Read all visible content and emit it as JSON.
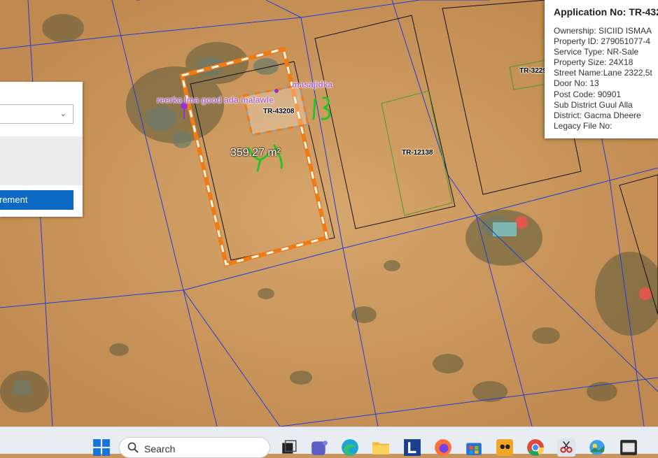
{
  "map": {
    "parcel_ids": {
      "subject": "TR-43208",
      "right": "TR-12138",
      "far_right": "TR-3229"
    },
    "poi_labels": {
      "left": "reerka lma good ada malawle",
      "right": "masajidka"
    },
    "measurement": "359.27 m²",
    "annotations": {
      "handwritten_number": "18",
      "handwritten_text": "ڈٹ"
    },
    "colors": {
      "selection": "#f07a14",
      "grid_lines": "#1e3fd6",
      "parcel_green": "#4c9a2a",
      "parcel_black": "#111111"
    }
  },
  "left_panel": {
    "button_label": "rement",
    "dropdown_value": ""
  },
  "popup": {
    "title": "Application No: TR-432",
    "ownership": "Ownership: SICIID ISMAA",
    "property_id": "Property ID: 279051077-4",
    "service_type": "Service Type: NR-Sale",
    "property_size": "Property Size: 24X18",
    "street_name": "Street Name:Lane 2322,5t",
    "door_no": "Door No: 13",
    "post_code": "Post Code: 90901",
    "sub_district": "Sub District Guul Alla",
    "district": "District: Gacma Dheere",
    "legacy_file": "Legacy File No:"
  },
  "taskbar": {
    "search_placeholder": "Search",
    "apps": [
      "windows-start-icon",
      "task-view-icon",
      "teams-icon",
      "edge-icon",
      "file-explorer-icon",
      "lens-l-icon",
      "firefox-icon",
      "store-icon",
      "game-icon",
      "chrome-icon",
      "snipping-tool-icon",
      "photos-icon",
      "terminal-icon"
    ]
  }
}
